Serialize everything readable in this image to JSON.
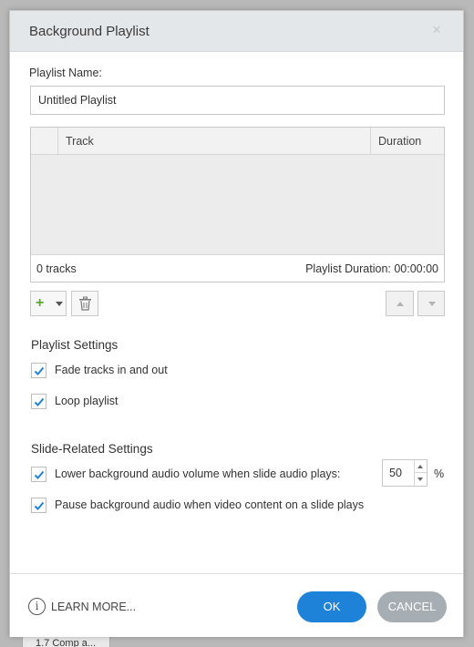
{
  "backdrop": {
    "tab_label": "1.7 Comp a..."
  },
  "dialog": {
    "title": "Background Playlist",
    "close_glyph": "×"
  },
  "playlist": {
    "name_label": "Playlist Name:",
    "name_value": "Untitled Playlist",
    "table": {
      "columns": [
        "",
        "Track",
        "Duration"
      ],
      "rows": [],
      "track_count": "0 tracks",
      "playlist_duration": "Playlist Duration: 00:00:00"
    },
    "toolbar": {
      "add_icon": "plus-icon",
      "delete_icon": "trash-icon",
      "move_up_icon": "arrow-up-icon",
      "move_down_icon": "arrow-down-icon"
    }
  },
  "playlist_settings": {
    "title": "Playlist Settings",
    "options": [
      {
        "label": "Fade tracks in and out",
        "checked": true
      },
      {
        "label": "Loop playlist",
        "checked": true
      }
    ]
  },
  "slide_settings": {
    "title": "Slide-Related Settings",
    "options": [
      {
        "label": "Lower background audio volume when slide audio plays:",
        "checked": true
      },
      {
        "label": "Pause background audio when video content on a slide plays",
        "checked": true
      }
    ],
    "volume_value": "50",
    "volume_unit": "%"
  },
  "footer": {
    "learn_more": "LEARN MORE...",
    "info_glyph": "i",
    "ok_label": "OK",
    "cancel_label": "CANCEL"
  },
  "colors": {
    "accent": "#1e83d8",
    "cancel": "#a6adb3",
    "check": "#1e83d8",
    "add_green": "#5aa832"
  }
}
